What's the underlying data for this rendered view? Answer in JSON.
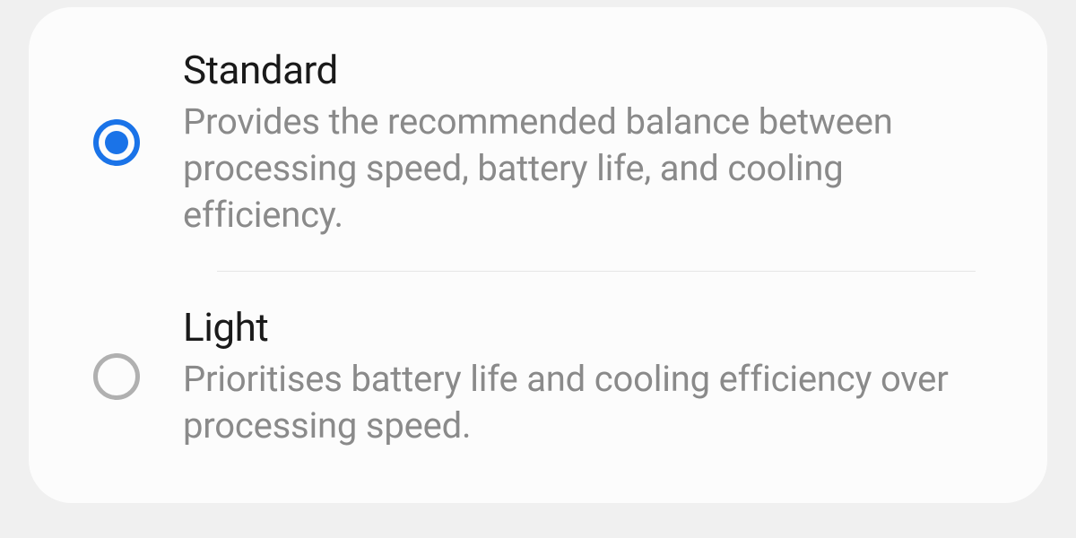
{
  "options": [
    {
      "title": "Standard",
      "description": "Provides the recommended balance between processing speed, battery life, and cooling efficiency.",
      "selected": true
    },
    {
      "title": "Light",
      "description": "Prioritises battery life and cooling efficiency over processing speed.",
      "selected": false
    }
  ],
  "colors": {
    "accent": "#1a73e8",
    "unselected": "#b0b0b0",
    "text_primary": "#1a1a1a",
    "text_secondary": "#8a8a8a"
  }
}
